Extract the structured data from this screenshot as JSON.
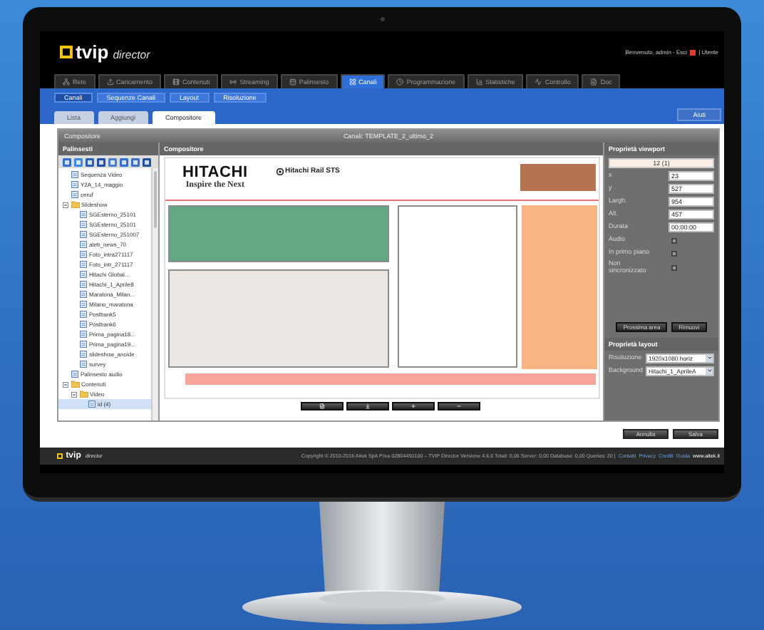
{
  "header": {
    "logo_text": "tvip",
    "logo_subtitle": "director",
    "welcome": "Benvenuto, admin - Esci",
    "user_link": "| Utente"
  },
  "main_tabs": [
    {
      "label": "Rete",
      "selected": false
    },
    {
      "label": "Caricamento",
      "selected": false
    },
    {
      "label": "Contenuti",
      "selected": false
    },
    {
      "label": "Streaming",
      "selected": false
    },
    {
      "label": "Palinsesto",
      "selected": false
    },
    {
      "label": "Canali",
      "selected": true
    },
    {
      "label": "Programmazione",
      "selected": false
    },
    {
      "label": "Statistiche",
      "selected": false
    },
    {
      "label": "Controllo",
      "selected": false
    },
    {
      "label": "Doc",
      "selected": false
    }
  ],
  "sub_tabs": [
    {
      "label": "Canali",
      "selected": true
    },
    {
      "label": "Sequenze Canali",
      "selected": false
    },
    {
      "label": "Layout",
      "selected": false
    },
    {
      "label": "Risoluzione",
      "selected": false
    }
  ],
  "page_tabs": [
    {
      "label": "Lista",
      "selected": false
    },
    {
      "label": "Aggiungi",
      "selected": false
    },
    {
      "label": "Compositore",
      "selected": true
    }
  ],
  "help_button": "Aiuti",
  "panel": {
    "title": "Compositore",
    "channel": "Canali: TEMPLATE_2_ultimo_2"
  },
  "schedules": {
    "title": "Palinsesti",
    "tree": [
      {
        "label": "Sequenza Video",
        "kind": "item",
        "selected": false
      },
      {
        "label": "Y2A_14_maggio",
        "kind": "item",
        "selected": false
      },
      {
        "label": "ceruf",
        "kind": "item",
        "selected": false
      },
      {
        "label": "Slideshow",
        "kind": "folder",
        "expanded": true,
        "selected": false,
        "children": [
          {
            "label": "SGEsterno_25101",
            "kind": "item",
            "selected": false
          },
          {
            "label": "SGEsterno_25101",
            "kind": "item",
            "selected": false
          },
          {
            "label": "SGEsterno_251007",
            "kind": "item",
            "selected": false
          },
          {
            "label": "ateb_news_70",
            "kind": "item",
            "selected": false
          },
          {
            "label": "Foto_intra271117",
            "kind": "item",
            "selected": false
          },
          {
            "label": "Foto_intr_271117",
            "kind": "item",
            "selected": false
          },
          {
            "label": "Hitachi Global...",
            "kind": "item",
            "selected": false
          },
          {
            "label": "Hitachi_1_Aprile8",
            "kind": "item",
            "selected": false
          },
          {
            "label": "Maratona_Milan...",
            "kind": "item",
            "selected": false
          },
          {
            "label": "Milano_maratona",
            "kind": "item",
            "selected": false
          },
          {
            "label": "Postbank5",
            "kind": "item",
            "selected": false
          },
          {
            "label": "Postbank6",
            "kind": "item",
            "selected": false
          },
          {
            "label": "Prima_pagina18...",
            "kind": "item",
            "selected": false
          },
          {
            "label": "Prima_pagina19...",
            "kind": "item",
            "selected": false
          },
          {
            "label": "slideshow_anoide",
            "kind": "item",
            "selected": false
          },
          {
            "label": "survey",
            "kind": "item",
            "selected": false
          }
        ]
      },
      {
        "label": "Palinsesto audio",
        "kind": "item",
        "selected": false
      },
      {
        "label": "Contenuti",
        "kind": "folder",
        "expanded": true,
        "selected": false,
        "children": [
          {
            "label": "Video",
            "kind": "folder",
            "expanded": true,
            "selected": false,
            "children": [
              {
                "label": "id (4)",
                "kind": "item",
                "selected": true
              }
            ]
          }
        ]
      }
    ]
  },
  "composer": {
    "title": "Compositore",
    "brand": "HITACHI",
    "tagline": "Inspire the Next",
    "division": "Hitachi Rail STS",
    "regions": [
      {
        "color": "#b5744f"
      },
      {
        "color": "#63a883"
      },
      {
        "color": "#ffffff"
      },
      {
        "color": "#f6b583"
      },
      {
        "color": "#ece6e2"
      },
      {
        "color": "#f7a49a"
      }
    ]
  },
  "viewport": {
    "title": "Proprietà viewport",
    "area": "12 (1)",
    "fields": [
      {
        "label": "x",
        "value": "23"
      },
      {
        "label": "y",
        "value": "527"
      },
      {
        "label": "Largh.",
        "value": "954"
      },
      {
        "label": "Alt.",
        "value": "457"
      },
      {
        "label": "Durata",
        "value": "00:00:00"
      }
    ],
    "checks": [
      {
        "label": "Audio",
        "checked": false
      },
      {
        "label": "In primo piano",
        "checked": false
      },
      {
        "label": "Non sincronizzato",
        "checked": false
      }
    ],
    "buttons": [
      "Prossima area",
      "Rimuovi"
    ]
  },
  "layout": {
    "title": "Proprietà layout",
    "selects": [
      {
        "label": "Risoluzione",
        "value": "1920x1080 horiz"
      },
      {
        "label": "Background",
        "value": "Hitachi_1_AprileA"
      }
    ]
  },
  "actions": [
    "Annulla",
    "Salva"
  ],
  "footer": {
    "logo_text": "tvip",
    "logo_subtitle": "director",
    "copyright": "Copyright © 2010-2016 Aitek SpA P.Iva 02804450100 – TVIP Director Versione 4.6.0 Totali: 0,06 Server: 0,00 Database: 0,00 Queries: 20 |",
    "links": [
      "Contatti",
      "Privacy",
      "Crediti",
      "Guida"
    ],
    "site": "www.aitek.it"
  }
}
